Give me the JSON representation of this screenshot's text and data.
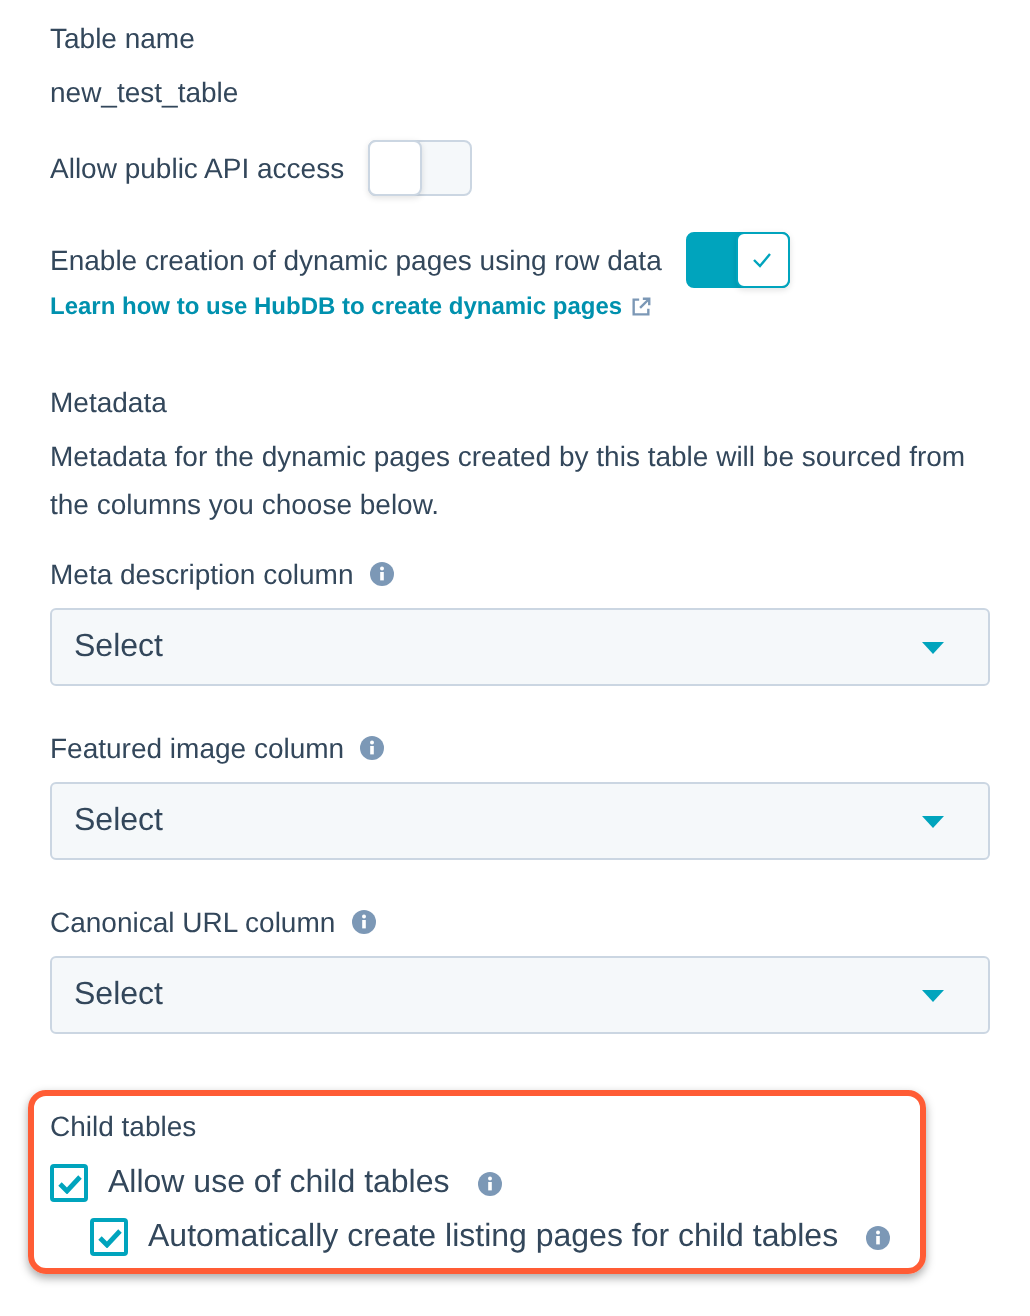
{
  "table_name": {
    "label": "Table name",
    "value": "new_test_table"
  },
  "toggles": [
    {
      "label": "Allow public API access",
      "on": false
    },
    {
      "label": "Enable creation of dynamic pages using row data",
      "on": true,
      "link": "Learn how to use HubDB to create dynamic pages"
    }
  ],
  "metadata": {
    "title": "Metadata",
    "description": "Metadata for the dynamic pages created by this table will be sourced from the columns you choose below.",
    "columns": [
      {
        "label": "Meta description column",
        "value": "Select"
      },
      {
        "label": "Featured image column",
        "value": "Select"
      },
      {
        "label": "Canonical URL column",
        "value": "Select"
      }
    ]
  },
  "child_tables": {
    "title": "Child tables",
    "options": [
      {
        "label": "Allow use of child tables",
        "checked": true,
        "children": [
          {
            "label": "Automatically create listing pages for child tables",
            "checked": true
          }
        ]
      }
    ]
  }
}
